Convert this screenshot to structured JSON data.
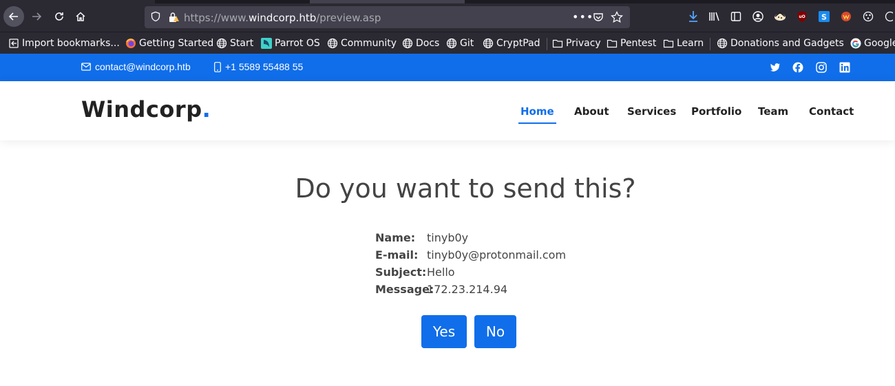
{
  "browser": {
    "url_scheme": "https://www.",
    "url_host": "windcorp.htb",
    "url_path": "/preview.asp",
    "more_label": "•••",
    "bookmarks": [
      {
        "label": "Import bookmarks...",
        "icon": "import-icon"
      },
      {
        "label": "Getting Started",
        "icon": "firefox-icon"
      },
      {
        "label": "Start",
        "icon": "globe-icon"
      },
      {
        "label": "Parrot OS",
        "icon": "parrot-icon"
      },
      {
        "label": "Community",
        "icon": "globe-icon"
      },
      {
        "label": "Docs",
        "icon": "globe-icon"
      },
      {
        "label": "Git",
        "icon": "globe-icon"
      },
      {
        "label": "CryptPad",
        "icon": "globe-icon"
      },
      {
        "label": "Privacy",
        "icon": "folder-icon"
      },
      {
        "label": "Pentest",
        "icon": "folder-icon"
      },
      {
        "label": "Learn",
        "icon": "folder-icon"
      },
      {
        "label": "Donations and Gadgets",
        "icon": "globe-icon"
      },
      {
        "label": "Google",
        "icon": "google-icon"
      }
    ]
  },
  "topbar": {
    "email": "contact@windcorp.htb",
    "phone": "+1 5589 55488 55",
    "social": [
      "twitter-icon",
      "facebook-icon",
      "instagram-icon",
      "linkedin-icon"
    ]
  },
  "header": {
    "logo": "Windcorp",
    "logo_dot": ".",
    "nav": [
      {
        "label": "Home",
        "active": true
      },
      {
        "label": "About"
      },
      {
        "label": "Services"
      },
      {
        "label": "Portfolio"
      },
      {
        "label": "Team"
      },
      {
        "label": "Contact"
      }
    ]
  },
  "main": {
    "title": "Do you want to send this?",
    "fields": [
      {
        "label": "Name:",
        "value": "tinyb0y"
      },
      {
        "label": "E-mail:",
        "value": "tinyb0y@protonmail.com"
      },
      {
        "label": "Subject:",
        "value": "Hello"
      },
      {
        "label": "Message:",
        "value": "172.23.214.94"
      }
    ],
    "yes_label": "Yes",
    "no_label": "No"
  },
  "colors": {
    "brand": "#106eea",
    "browser_bg": "#2b2a33",
    "text": "#444444"
  }
}
